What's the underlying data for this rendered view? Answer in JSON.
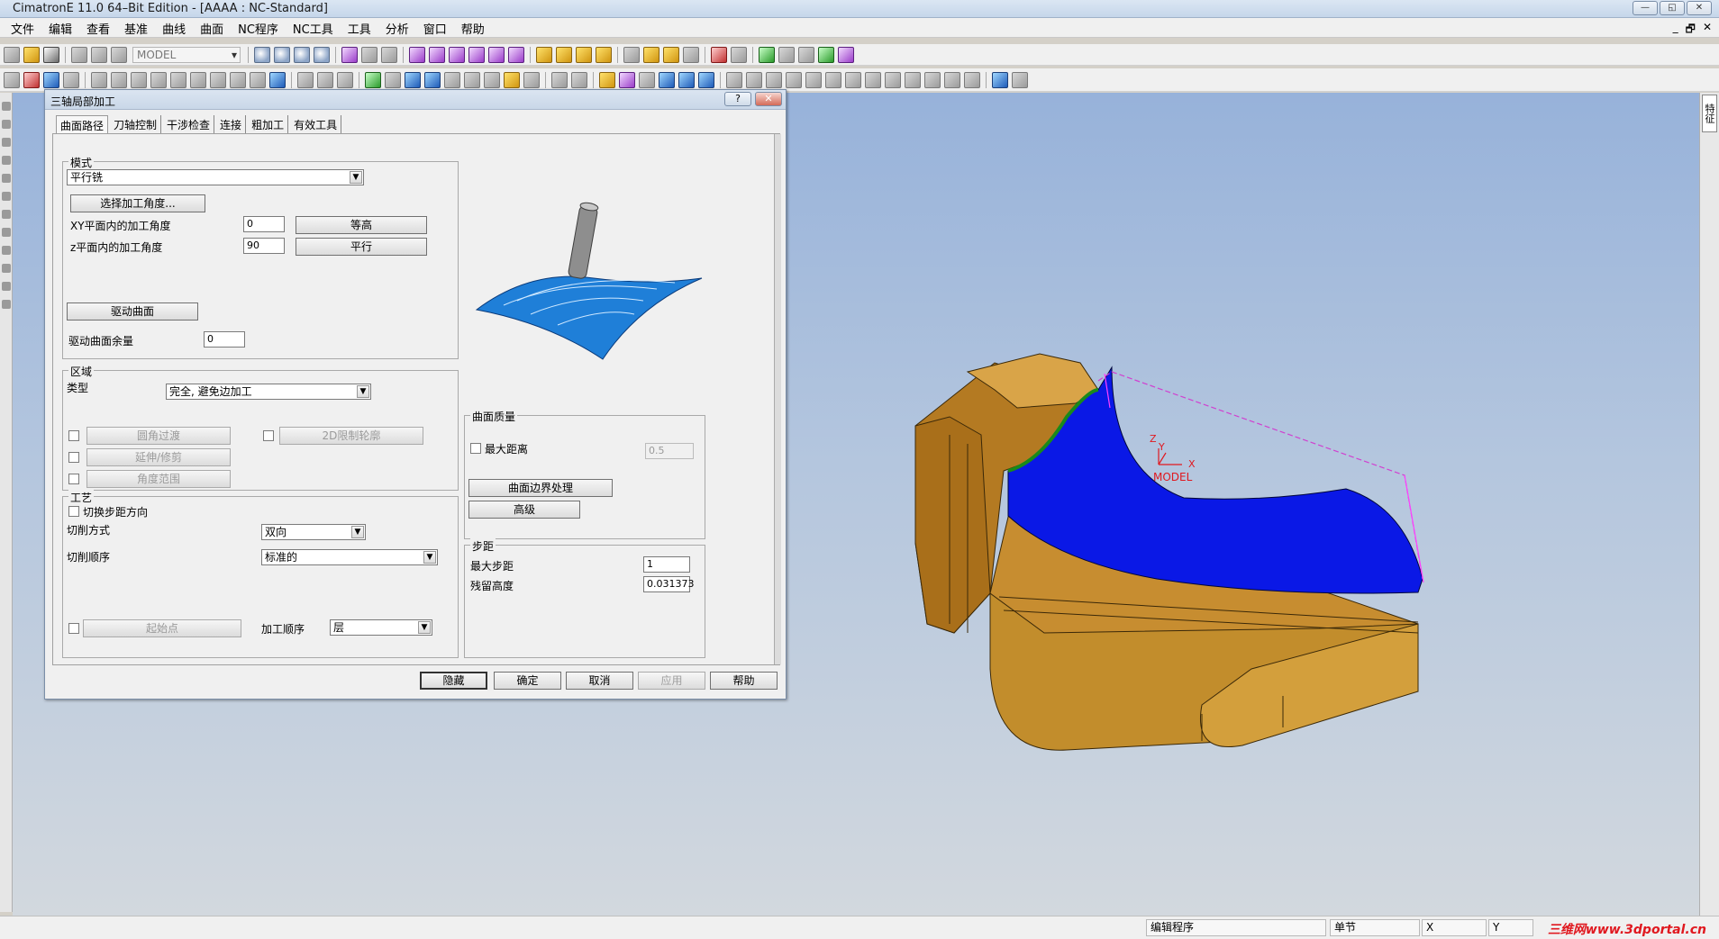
{
  "window": {
    "title": "CimatronE 11.0 64–Bit Edition - [AAAA : NC-Standard]",
    "buttons": [
      "—",
      "◱",
      "✕"
    ]
  },
  "menu": [
    "文件",
    "编辑",
    "查看",
    "基准",
    "曲线",
    "曲面",
    "NC程序",
    "NC工具",
    "工具",
    "分析",
    "窗口",
    "帮助"
  ],
  "mdi_buttons": [
    "_",
    "🗗",
    "✕"
  ],
  "toolbar": {
    "model_combo": "MODEL"
  },
  "right_tab": "特征",
  "dialog": {
    "title": "三轴局部加工",
    "title_help": "?",
    "title_close": "✕",
    "tabs": [
      "曲面路径",
      "刀轴控制",
      "干涉检查",
      "连接",
      "粗加工",
      "有效工具"
    ],
    "mode": {
      "legend": "模式",
      "combo": "平行铣",
      "select_angle_btn": "选择加工角度...",
      "xy_label": "XY平面内的加工角度",
      "xy_value": "0",
      "contour_btn": "等高",
      "z_label": "z平面内的加工角度",
      "z_value": "90",
      "parallel_btn": "平行",
      "drive_surface_btn": "驱动曲面",
      "drive_allowance_label": "驱动曲面余量",
      "drive_allowance_value": "0"
    },
    "region": {
      "legend": "区域",
      "type_label": "类型",
      "type_value": "完全, 避免边加工",
      "fillet_btn": "圆角过渡",
      "extend_btn": "延伸/修剪",
      "angle_range_btn": "角度范围",
      "contour2d_btn": "2D限制轮廓"
    },
    "process": {
      "legend": "工艺",
      "switch_step_label": "切换步距方向",
      "cut_mode_label": "切削方式",
      "cut_mode_value": "双向",
      "cut_order_label": "切削顺序",
      "cut_order_value": "标准的",
      "start_point_btn": "起始点",
      "machining_order_label": "加工顺序",
      "machining_order_value": "层"
    },
    "surface_quality": {
      "legend": "曲面质量",
      "max_distance_label": "最大距离",
      "max_distance_value": "0.5",
      "boundary_btn": "曲面边界处理",
      "advanced_btn": "高级"
    },
    "stepover": {
      "legend": "步距",
      "max_step_label": "最大步距",
      "max_step_value": "1",
      "scallop_label": "残留高度",
      "scallop_value": "0.031373"
    },
    "buttons": {
      "hide": "隐藏",
      "ok": "确定",
      "cancel": "取消",
      "apply": "应用",
      "help": "帮助"
    }
  },
  "viewport": {
    "ucs_labels": {
      "z": "Z",
      "y": "Y",
      "x": "X"
    },
    "model_csys": {
      "z": "Z",
      "y": "Y",
      "x": "X",
      "name": "MODEL"
    }
  },
  "statusbar": {
    "edit": "编辑程序",
    "mode": "单节",
    "x": "X",
    "y": "Y",
    "watermark": "三维网www.3dportal.cn"
  },
  "colors": {
    "part": "#c08a2a",
    "surface": "#0a18e6",
    "accent_red": "#e0181f"
  }
}
